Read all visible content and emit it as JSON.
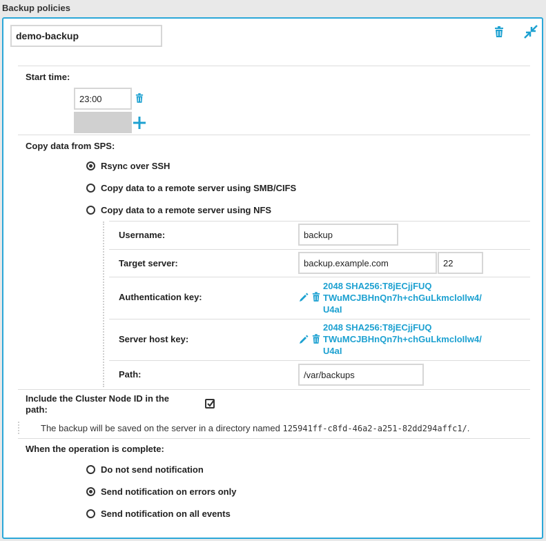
{
  "section": {
    "title": "Backup policies"
  },
  "policy": {
    "name": "demo-backup"
  },
  "start_time": {
    "label": "Start time:",
    "value": "23:00"
  },
  "copy": {
    "label": "Copy data from SPS:",
    "options": [
      {
        "label": "Rsync over SSH",
        "checked": true
      },
      {
        "label": "Copy data to a remote server using SMB/CIFS",
        "checked": false
      },
      {
        "label": "Copy data to a remote server using NFS",
        "checked": false
      }
    ],
    "username_label": "Username:",
    "username": "backup",
    "target_label": "Target server:",
    "target_host": "backup.example.com",
    "target_port": "22",
    "auth_label": "Authentication key:",
    "auth_key": [
      "2048 SHA256:T8jECjjFUQ",
      "TWuMCJBHnQn7h+chGuLkmcloIlw4/",
      "U4aI"
    ],
    "host_label": "Server host key:",
    "host_key": [
      "2048 SHA256:T8jECjjFUQ",
      "TWuMCJBHnQn7h+chGuLkmcloIlw4/",
      "U4aI"
    ],
    "path_label": "Path:",
    "path": "/var/backups"
  },
  "cluster": {
    "label_line1": "Include the Cluster Node ID in the",
    "label_line2": "path:",
    "checked": true,
    "info_prefix": "The backup will be saved on the server in a directory named ",
    "info_id": "125941ff-c8fd-46a2-a251-82dd294affc1/",
    "info_suffix": "."
  },
  "notify": {
    "label": "When the operation is complete:",
    "options": [
      {
        "label": "Do not send notification",
        "checked": false
      },
      {
        "label": "Send notification on errors only",
        "checked": true
      },
      {
        "label": "Send notification on all events",
        "checked": false
      }
    ]
  },
  "colors": {
    "accent": "#1da1d1",
    "border": "#2aa7d8"
  },
  "icons": {
    "delete": "trash-icon",
    "collapse": "collapse-icon",
    "add": "plus-icon",
    "edit": "pencil-icon"
  }
}
